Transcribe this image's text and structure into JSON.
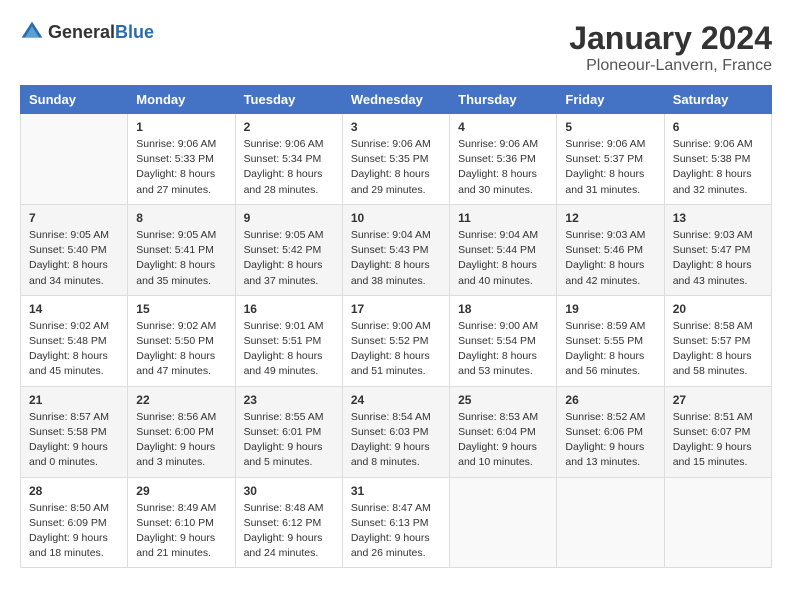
{
  "header": {
    "logo_general": "General",
    "logo_blue": "Blue",
    "month_title": "January 2024",
    "location": "Ploneour-Lanvern, France"
  },
  "days_of_week": [
    "Sunday",
    "Monday",
    "Tuesday",
    "Wednesday",
    "Thursday",
    "Friday",
    "Saturday"
  ],
  "weeks": [
    [
      {
        "day": "",
        "sunrise": "",
        "sunset": "",
        "daylight": ""
      },
      {
        "day": "1",
        "sunrise": "Sunrise: 9:06 AM",
        "sunset": "Sunset: 5:33 PM",
        "daylight": "Daylight: 8 hours and 27 minutes."
      },
      {
        "day": "2",
        "sunrise": "Sunrise: 9:06 AM",
        "sunset": "Sunset: 5:34 PM",
        "daylight": "Daylight: 8 hours and 28 minutes."
      },
      {
        "day": "3",
        "sunrise": "Sunrise: 9:06 AM",
        "sunset": "Sunset: 5:35 PM",
        "daylight": "Daylight: 8 hours and 29 minutes."
      },
      {
        "day": "4",
        "sunrise": "Sunrise: 9:06 AM",
        "sunset": "Sunset: 5:36 PM",
        "daylight": "Daylight: 8 hours and 30 minutes."
      },
      {
        "day": "5",
        "sunrise": "Sunrise: 9:06 AM",
        "sunset": "Sunset: 5:37 PM",
        "daylight": "Daylight: 8 hours and 31 minutes."
      },
      {
        "day": "6",
        "sunrise": "Sunrise: 9:06 AM",
        "sunset": "Sunset: 5:38 PM",
        "daylight": "Daylight: 8 hours and 32 minutes."
      }
    ],
    [
      {
        "day": "7",
        "sunrise": "Sunrise: 9:05 AM",
        "sunset": "Sunset: 5:40 PM",
        "daylight": "Daylight: 8 hours and 34 minutes."
      },
      {
        "day": "8",
        "sunrise": "Sunrise: 9:05 AM",
        "sunset": "Sunset: 5:41 PM",
        "daylight": "Daylight: 8 hours and 35 minutes."
      },
      {
        "day": "9",
        "sunrise": "Sunrise: 9:05 AM",
        "sunset": "Sunset: 5:42 PM",
        "daylight": "Daylight: 8 hours and 37 minutes."
      },
      {
        "day": "10",
        "sunrise": "Sunrise: 9:04 AM",
        "sunset": "Sunset: 5:43 PM",
        "daylight": "Daylight: 8 hours and 38 minutes."
      },
      {
        "day": "11",
        "sunrise": "Sunrise: 9:04 AM",
        "sunset": "Sunset: 5:44 PM",
        "daylight": "Daylight: 8 hours and 40 minutes."
      },
      {
        "day": "12",
        "sunrise": "Sunrise: 9:03 AM",
        "sunset": "Sunset: 5:46 PM",
        "daylight": "Daylight: 8 hours and 42 minutes."
      },
      {
        "day": "13",
        "sunrise": "Sunrise: 9:03 AM",
        "sunset": "Sunset: 5:47 PM",
        "daylight": "Daylight: 8 hours and 43 minutes."
      }
    ],
    [
      {
        "day": "14",
        "sunrise": "Sunrise: 9:02 AM",
        "sunset": "Sunset: 5:48 PM",
        "daylight": "Daylight: 8 hours and 45 minutes."
      },
      {
        "day": "15",
        "sunrise": "Sunrise: 9:02 AM",
        "sunset": "Sunset: 5:50 PM",
        "daylight": "Daylight: 8 hours and 47 minutes."
      },
      {
        "day": "16",
        "sunrise": "Sunrise: 9:01 AM",
        "sunset": "Sunset: 5:51 PM",
        "daylight": "Daylight: 8 hours and 49 minutes."
      },
      {
        "day": "17",
        "sunrise": "Sunrise: 9:00 AM",
        "sunset": "Sunset: 5:52 PM",
        "daylight": "Daylight: 8 hours and 51 minutes."
      },
      {
        "day": "18",
        "sunrise": "Sunrise: 9:00 AM",
        "sunset": "Sunset: 5:54 PM",
        "daylight": "Daylight: 8 hours and 53 minutes."
      },
      {
        "day": "19",
        "sunrise": "Sunrise: 8:59 AM",
        "sunset": "Sunset: 5:55 PM",
        "daylight": "Daylight: 8 hours and 56 minutes."
      },
      {
        "day": "20",
        "sunrise": "Sunrise: 8:58 AM",
        "sunset": "Sunset: 5:57 PM",
        "daylight": "Daylight: 8 hours and 58 minutes."
      }
    ],
    [
      {
        "day": "21",
        "sunrise": "Sunrise: 8:57 AM",
        "sunset": "Sunset: 5:58 PM",
        "daylight": "Daylight: 9 hours and 0 minutes."
      },
      {
        "day": "22",
        "sunrise": "Sunrise: 8:56 AM",
        "sunset": "Sunset: 6:00 PM",
        "daylight": "Daylight: 9 hours and 3 minutes."
      },
      {
        "day": "23",
        "sunrise": "Sunrise: 8:55 AM",
        "sunset": "Sunset: 6:01 PM",
        "daylight": "Daylight: 9 hours and 5 minutes."
      },
      {
        "day": "24",
        "sunrise": "Sunrise: 8:54 AM",
        "sunset": "Sunset: 6:03 PM",
        "daylight": "Daylight: 9 hours and 8 minutes."
      },
      {
        "day": "25",
        "sunrise": "Sunrise: 8:53 AM",
        "sunset": "Sunset: 6:04 PM",
        "daylight": "Daylight: 9 hours and 10 minutes."
      },
      {
        "day": "26",
        "sunrise": "Sunrise: 8:52 AM",
        "sunset": "Sunset: 6:06 PM",
        "daylight": "Daylight: 9 hours and 13 minutes."
      },
      {
        "day": "27",
        "sunrise": "Sunrise: 8:51 AM",
        "sunset": "Sunset: 6:07 PM",
        "daylight": "Daylight: 9 hours and 15 minutes."
      }
    ],
    [
      {
        "day": "28",
        "sunrise": "Sunrise: 8:50 AM",
        "sunset": "Sunset: 6:09 PM",
        "daylight": "Daylight: 9 hours and 18 minutes."
      },
      {
        "day": "29",
        "sunrise": "Sunrise: 8:49 AM",
        "sunset": "Sunset: 6:10 PM",
        "daylight": "Daylight: 9 hours and 21 minutes."
      },
      {
        "day": "30",
        "sunrise": "Sunrise: 8:48 AM",
        "sunset": "Sunset: 6:12 PM",
        "daylight": "Daylight: 9 hours and 24 minutes."
      },
      {
        "day": "31",
        "sunrise": "Sunrise: 8:47 AM",
        "sunset": "Sunset: 6:13 PM",
        "daylight": "Daylight: 9 hours and 26 minutes."
      },
      {
        "day": "",
        "sunrise": "",
        "sunset": "",
        "daylight": ""
      },
      {
        "day": "",
        "sunrise": "",
        "sunset": "",
        "daylight": ""
      },
      {
        "day": "",
        "sunrise": "",
        "sunset": "",
        "daylight": ""
      }
    ]
  ]
}
